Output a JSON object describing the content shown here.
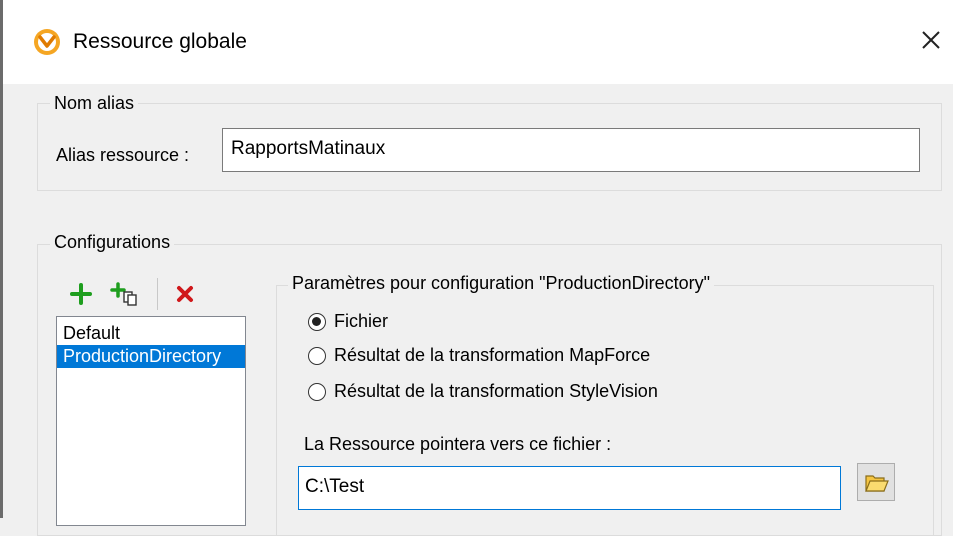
{
  "dialog": {
    "title": "Ressource globale",
    "icon": "altova-logo-icon",
    "close_icon": "close-icon"
  },
  "alias_group": {
    "legend": "Nom alias",
    "label": "Alias ressource :",
    "value": "RapportsMatinaux"
  },
  "configurations": {
    "legend": "Configurations",
    "toolbar": [
      {
        "name": "add-configuration-button",
        "icon": "green-plus-icon"
      },
      {
        "name": "copy-configuration-button",
        "icon": "green-plus-copy-icon"
      },
      {
        "name": "delete-configuration-button",
        "icon": "red-x-icon"
      }
    ],
    "items": [
      "Default",
      "ProductionDirectory"
    ],
    "selected_index": 1
  },
  "settings": {
    "legend": "Paramètres pour configuration \"ProductionDirectory\"",
    "options": [
      {
        "label": "Fichier",
        "checked": true
      },
      {
        "label": "Résultat de la transformation MapForce",
        "checked": false
      },
      {
        "label": "Résultat de la transformation StyleVision",
        "checked": false
      }
    ],
    "file_label": "La Ressource pointera vers ce fichier :",
    "file_value": "C:\\Test",
    "browse_icon": "open-folder-icon"
  }
}
